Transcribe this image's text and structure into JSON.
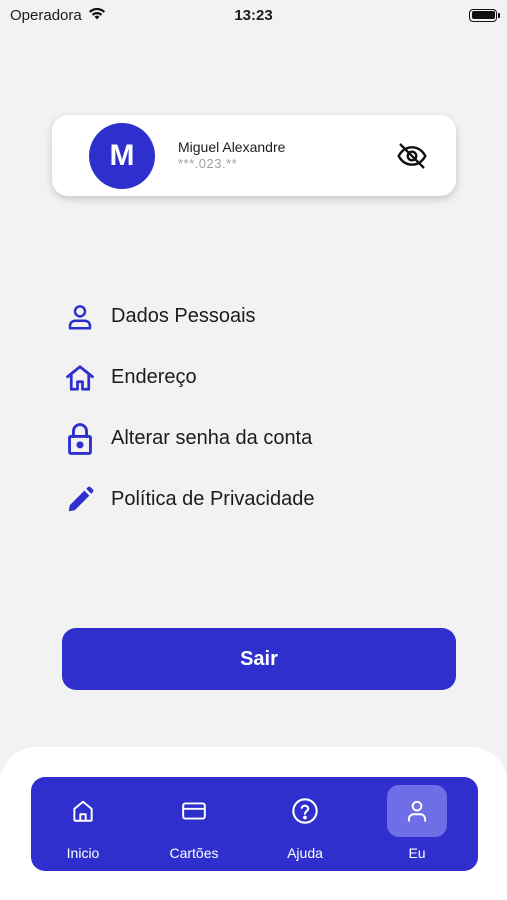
{
  "status_bar": {
    "carrier": "Operadora",
    "time": "13:23",
    "wifi_icon": "wifi-icon",
    "battery_icon": "battery-icon"
  },
  "profile": {
    "avatar_initial": "M",
    "name": "Miguel Alexandre",
    "masked_document": "***.023.**",
    "visibility_icon": "eye-off-icon"
  },
  "menu": {
    "items": [
      {
        "label": "Dados Pessoais",
        "icon": "person-icon"
      },
      {
        "label": "Endereço",
        "icon": "home-icon"
      },
      {
        "label": "Alterar senha da conta",
        "icon": "lock-icon"
      },
      {
        "label": "Política de Privacidade",
        "icon": "pencil-icon"
      }
    ]
  },
  "logout": {
    "label": "Sair"
  },
  "tab_bar": {
    "active_index": 3,
    "tabs": [
      {
        "label": "Inicio",
        "icon": "home-icon"
      },
      {
        "label": "Cartões",
        "icon": "card-icon"
      },
      {
        "label": "Ajuda",
        "icon": "help-icon"
      },
      {
        "label": "Eu",
        "icon": "person-icon"
      }
    ]
  },
  "colors": {
    "accent": "#2f2fce",
    "active_tab_bg": "#6e6fe6",
    "background": "#f2f2f3",
    "card": "#ffffff",
    "muted_text": "#a0a0a6"
  }
}
